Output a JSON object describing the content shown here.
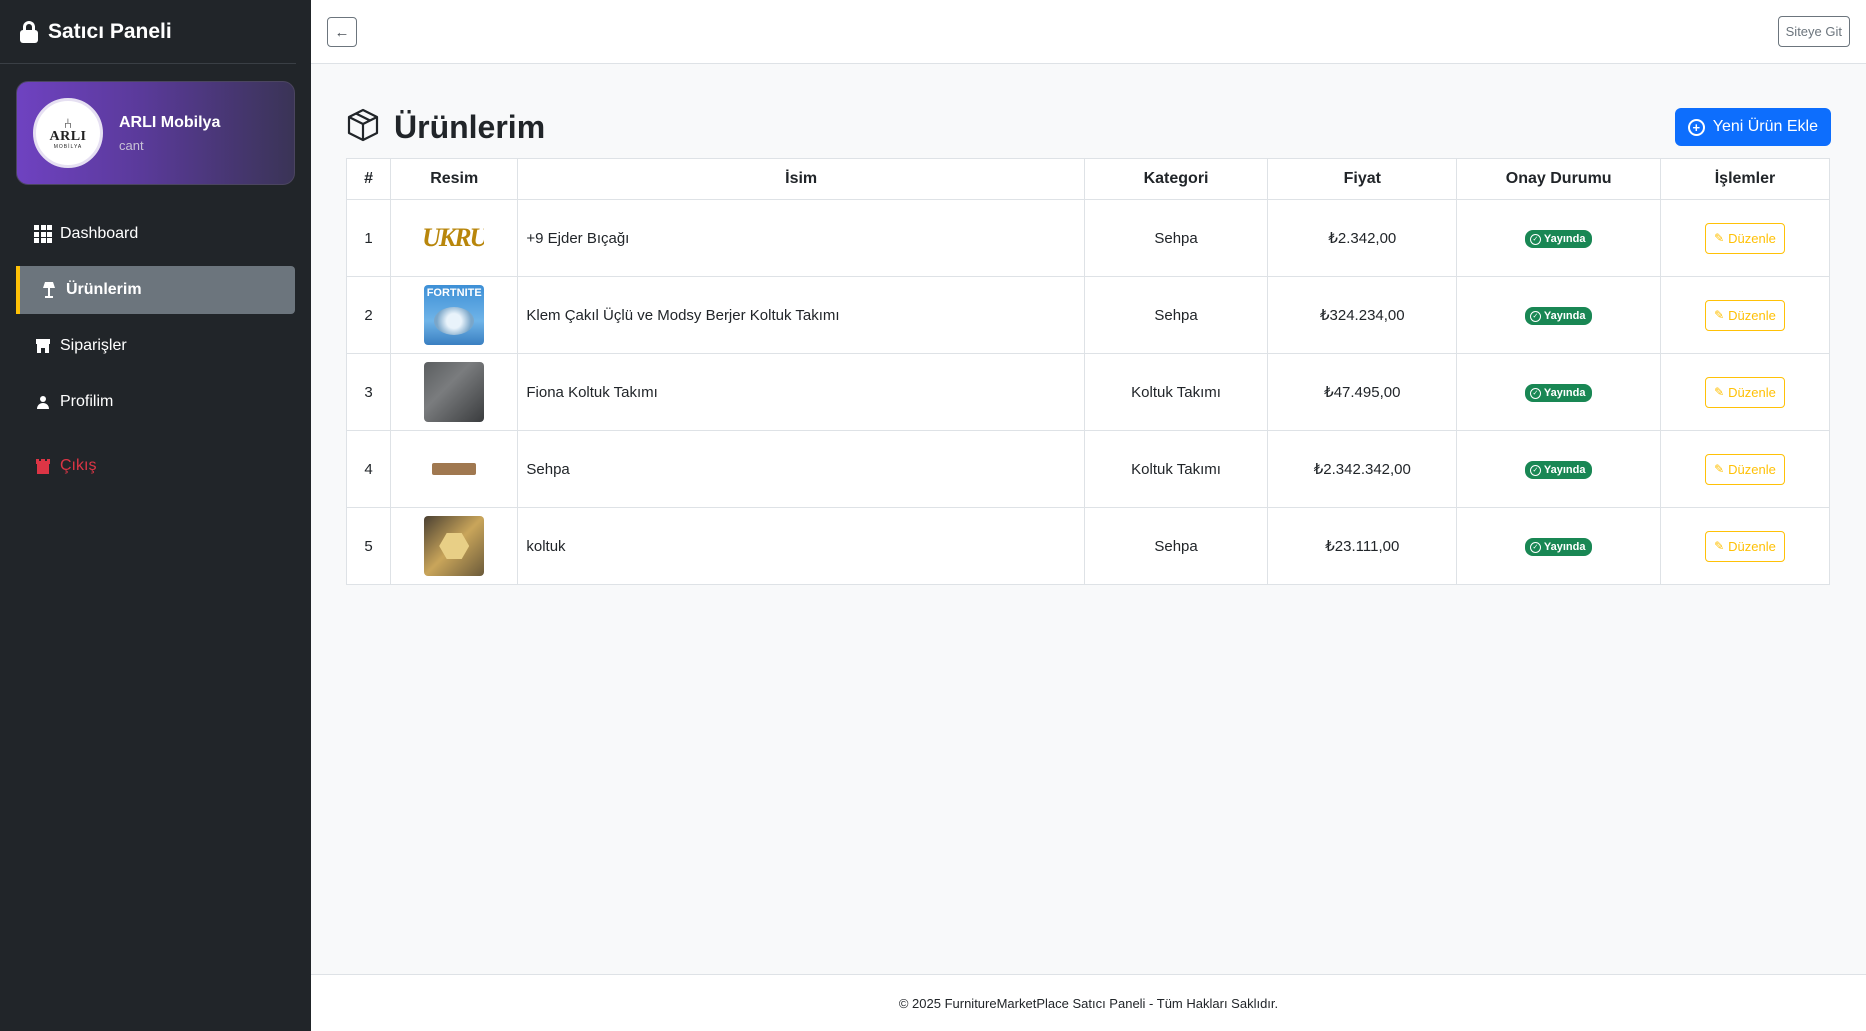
{
  "sidebar": {
    "brand_title": "Satıcı Paneli",
    "profile": {
      "name": "ARLI Mobilya",
      "subtitle": "cant",
      "logo_text": "ARLI",
      "logo_sub": "MOBİLYA"
    },
    "items": [
      {
        "label": "Dashboard",
        "icon": "grid-icon"
      },
      {
        "label": "Ürünlerim",
        "icon": "lamp-icon",
        "active": true
      },
      {
        "label": "Siparişler",
        "icon": "shop-icon"
      },
      {
        "label": "Profilim",
        "icon": "person-icon"
      },
      {
        "label": "Çıkış",
        "icon": "castle-icon"
      }
    ]
  },
  "topbar": {
    "back_icon": "arrow-left-icon",
    "site_label": "Siteye Git"
  },
  "main": {
    "title": "Ürünlerim",
    "add_button": "Yeni Ürün Ekle",
    "table": {
      "headers": [
        "#",
        "Resim",
        "İsim",
        "Kategori",
        "Fiyat",
        "Onay Durumu",
        "İşlemler"
      ],
      "rows": [
        {
          "no": "1",
          "name": "+9 Ejder Bıçağı",
          "category": "Sehpa",
          "price": "₺2.342,00",
          "status": "Yayında",
          "action": "Düzenle"
        },
        {
          "no": "2",
          "name": "Klem Çakıl Üçlü ve Modsy Berjer Koltuk Takımı",
          "category": "Sehpa",
          "price": "₺324.234,00",
          "status": "Yayında",
          "action": "Düzenle"
        },
        {
          "no": "3",
          "name": "Fiona Koltuk Takımı",
          "category": "Koltuk Takımı",
          "price": "₺47.495,00",
          "status": "Yayında",
          "action": "Düzenle"
        },
        {
          "no": "4",
          "name": "Sehpa",
          "category": "Koltuk Takımı",
          "price": "₺2.342.342,00",
          "status": "Yayında",
          "action": "Düzenle"
        },
        {
          "no": "5",
          "name": "koltuk",
          "category": "Sehpa",
          "price": "₺23.111,00",
          "status": "Yayında",
          "action": "Düzenle"
        }
      ]
    },
    "thumb_text": {
      "t1": "UKRU",
      "t2": "FORTNITE"
    }
  },
  "footer": {
    "text": "© 2025 FurnitureMarketPlace Satıcı Paneli - Tüm Hakları Saklıdır."
  },
  "colors": {
    "primary": "#0d6efd",
    "warning": "#ffc107",
    "success": "#198754",
    "danger": "#dc3545",
    "sidebar_bg": "#212529"
  }
}
